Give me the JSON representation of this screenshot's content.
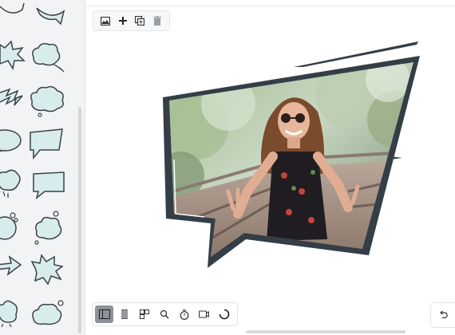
{
  "app": {
    "accent": "#8e9296",
    "frame_color": "#343e47",
    "speech_fill": "#d8ecec"
  },
  "shapes_panel": {
    "items": [
      "speech-bubble-oval-icon",
      "spiky-burst-bubble-icon",
      "cloud-thought-bubble-icon",
      "lightning-zigzag-icon",
      "cloud-bubble-icon",
      "oval-speech-bubble-icon",
      "angled-rectangle-bubble-icon",
      "splash-cloud-bubble-icon",
      "rectangle-speech-bubble-icon",
      "circle-bubble-icon",
      "thought-cloud-bubble-icon",
      "arrow-shape-icon",
      "explosion-bubble-icon",
      "splash-bubble-icon",
      "cloud-bubble-small-icon"
    ]
  },
  "top_toolbar": {
    "icons": [
      "image-icon",
      "plus-icon",
      "duplicate-icon",
      "trash-icon"
    ]
  },
  "canvas": {
    "photo_description_icon": "photo-image"
  },
  "bottom_toolbar": {
    "icons": [
      "layout-panel-icon",
      "vertical-split-icon",
      "grid-layout-icon",
      "zoom-icon",
      "timer-icon",
      "video-icon",
      "loading-spinner-icon"
    ],
    "active_index": 0
  },
  "undo": {
    "icon": "undo-icon"
  }
}
